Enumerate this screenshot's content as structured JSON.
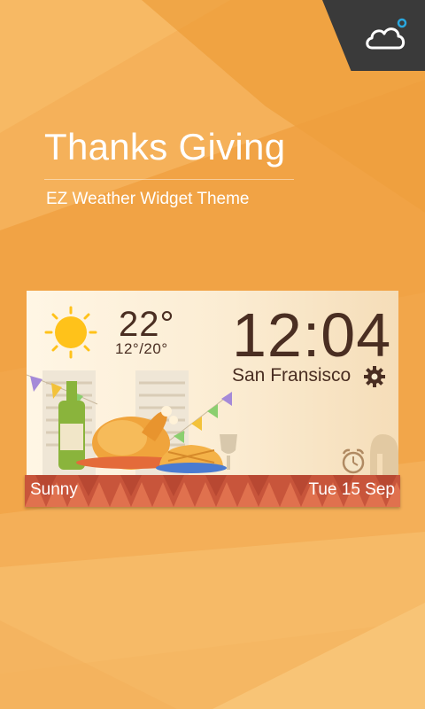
{
  "header": {
    "title": "Thanks Giving",
    "subtitle": "EZ Weather Widget Theme",
    "corner_icon": "cloud-icon",
    "corner_bg": "#3a3a3a",
    "notification_dot_color": "#29a8e0"
  },
  "widget": {
    "temperature": "22°",
    "temp_range": "12°/20°",
    "time": "12:04",
    "city": "San Fransisco",
    "condition": "Sunny",
    "date": "Tue 15 Sep",
    "weather_icon": "sun-icon",
    "settings_icon": "gear-icon",
    "alarm_icon": "alarm-clock-icon"
  },
  "colors": {
    "background": "#f2a84a",
    "text_dark": "#4a2e22",
    "strip": "#c8553b",
    "sun": "#ffc21a"
  }
}
